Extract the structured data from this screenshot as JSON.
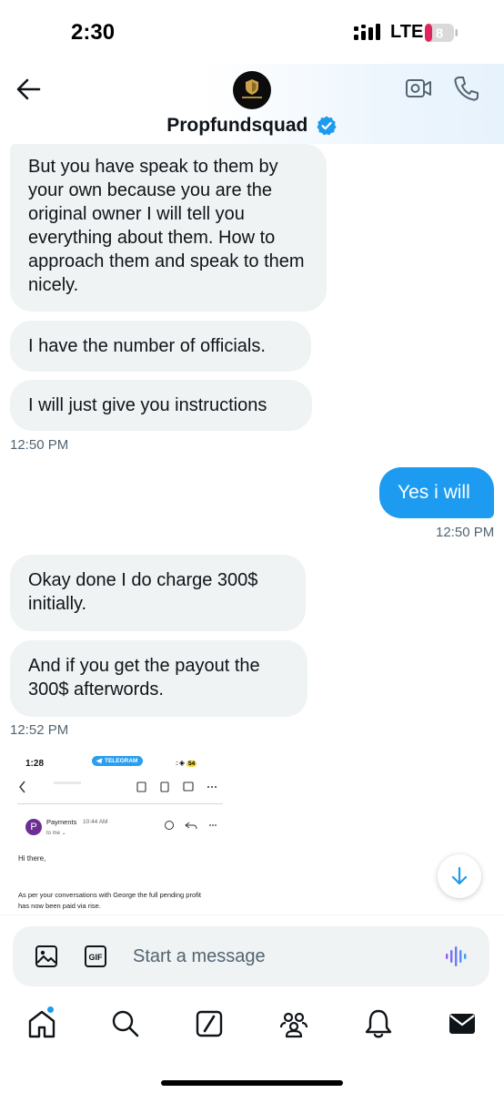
{
  "status_bar": {
    "time": "2:30",
    "network": "LTE",
    "battery": "8"
  },
  "header": {
    "contact_name": "Propfundsquad",
    "avatar_text": "PROPFUNDSQUAD"
  },
  "messages": {
    "m1": "But you have speak to them by your own because you are the original owner I will tell you everything about them. How to approach them and speak to them nicely.",
    "m2": "I have the number of officials.",
    "m3": "I will just give you instructions",
    "t1": "12:50 PM",
    "m4": "Yes i will",
    "t2": "12:50 PM",
    "m5": "Okay done I do charge 300$ initially.",
    "m6": "And if you get the payout the 300$ afterwords.",
    "t3": "12:52 PM"
  },
  "attachment": {
    "time": "1:28",
    "badge": "TELEGRAM",
    "battery": "54",
    "sender": "Payments",
    "sent_time": "10:44 AM",
    "to": "to me",
    "avatar_letter": "P",
    "greeting": "Hi there,",
    "body": "As per your conversations with George the full pending profit has now been paid via rise."
  },
  "composer": {
    "placeholder": "Start a message",
    "gif_label": "GIF"
  },
  "colors": {
    "accent": "#1d9bf0",
    "bubble_in": "#eff3f4",
    "text": "#0f1419",
    "muted": "#536471",
    "battery_low": "#e0245e"
  },
  "icons": [
    "back-arrow-icon",
    "video-icon",
    "phone-icon",
    "verified-badge-icon",
    "arrow-down-icon",
    "image-icon",
    "gif-icon",
    "voice-icon",
    "home-icon",
    "search-icon",
    "grok-icon",
    "communities-icon",
    "notifications-icon",
    "messages-icon"
  ]
}
